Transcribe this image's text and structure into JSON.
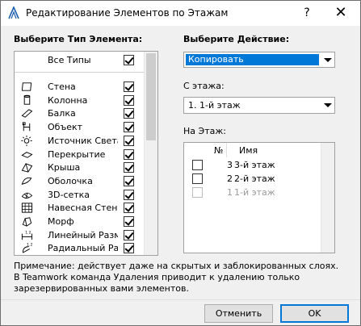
{
  "window": {
    "title": "Редактирование Элементов по Этажам",
    "help_label": "?",
    "close_label": "✕"
  },
  "element_type": {
    "heading": "Выберите Тип Элемента:",
    "all_label": "Все Типы",
    "all_checked": true,
    "items": [
      {
        "label": "Стена",
        "icon": "wall-icon",
        "checked": true
      },
      {
        "label": "Колонна",
        "icon": "column-icon",
        "checked": true
      },
      {
        "label": "Балка",
        "icon": "beam-icon",
        "checked": true
      },
      {
        "label": "Объект",
        "icon": "object-icon",
        "checked": true
      },
      {
        "label": "Источник Света",
        "icon": "lamp-icon",
        "checked": true
      },
      {
        "label": "Перекрытие",
        "icon": "slab-icon",
        "checked": true
      },
      {
        "label": "Крыша",
        "icon": "roof-icon",
        "checked": true
      },
      {
        "label": "Оболочка",
        "icon": "shell-icon",
        "checked": true
      },
      {
        "label": "3D-сетка",
        "icon": "mesh-icon",
        "checked": true
      },
      {
        "label": "Навесная Стена",
        "icon": "curtain-wall-icon",
        "checked": true
      },
      {
        "label": "Морф",
        "icon": "morph-icon",
        "checked": true
      },
      {
        "label": "Линейный Размер",
        "icon": "linear-dimension-icon",
        "checked": true
      },
      {
        "label": "Радиальный Размер",
        "icon": "radial-dimension-icon",
        "checked": true
      }
    ]
  },
  "action": {
    "heading": "Выберите Действие:",
    "selected": "Копировать"
  },
  "from_floor": {
    "label": "С этажа:",
    "selected": "1. 1-й этаж"
  },
  "to_floor": {
    "label": "На Этаж:",
    "columns": {
      "number": "№",
      "name": "Имя"
    },
    "rows": [
      {
        "number": "3",
        "name": "3-й этаж",
        "checked": false,
        "enabled": true
      },
      {
        "number": "2",
        "name": "2-й этаж",
        "checked": false,
        "enabled": true
      },
      {
        "number": "1",
        "name": "1-й этаж",
        "checked": false,
        "enabled": false
      }
    ]
  },
  "note": {
    "line1": "Примечание: действует даже на скрытых и заблокированных слоях.",
    "line2": "В Teamwork команда Удаления приводит к удалению только",
    "line3": "зарезервированных вами элементов."
  },
  "buttons": {
    "cancel": "Отменить",
    "ok": "OK"
  },
  "colors": {
    "selection": "#0078d7",
    "dialog_bg": "#f0f0f0"
  }
}
